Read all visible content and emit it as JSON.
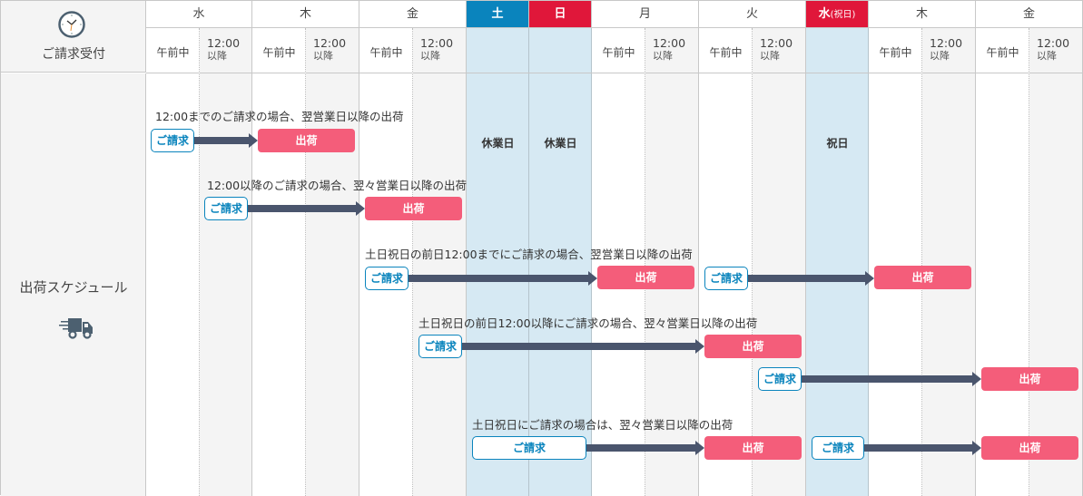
{
  "header": {
    "reception_label": "ご請求受付",
    "clock_icon": "clock-icon",
    "days": [
      {
        "label": "水",
        "type": "weekday"
      },
      {
        "label": "木",
        "type": "weekday"
      },
      {
        "label": "金",
        "type": "weekday"
      },
      {
        "label": "土",
        "type": "saturday"
      },
      {
        "label": "日",
        "type": "sunday"
      },
      {
        "label": "月",
        "type": "weekday"
      },
      {
        "label": "火",
        "type": "weekday"
      },
      {
        "label": "水",
        "sub": "(祝日)",
        "type": "holiday"
      },
      {
        "label": "木",
        "type": "weekday"
      },
      {
        "label": "金",
        "type": "weekday"
      }
    ],
    "slot_am": "午前中",
    "slot_pm_time": "12:00",
    "slot_pm_sub": "以降"
  },
  "schedule": {
    "label": "出荷スケジュール",
    "truck_icon": "delivery-truck-icon",
    "off_labels": {
      "sat": "休業日",
      "sun": "休業日",
      "holiday": "祝日"
    },
    "request_label": "ご請求",
    "ship_label": "出荷",
    "rules": [
      "12:00までのご請求の場合、翌営業日以降の出荷",
      "12:00以降のご請求の場合、翌々営業日以降の出荷",
      "土日祝日の前日12:00までにご請求の場合、翌営業日以降の出荷",
      "土日祝日の前日12:00以降にご請求の場合、翌々営業日以降の出荷",
      "土日祝日にご請求の場合は、翌々営業日以降の出荷"
    ]
  },
  "colors": {
    "saturday": "#0a84bd",
    "sunday_holiday": "#e0173a",
    "offday_bg": "#d6e9f3",
    "ship": "#f45d7a",
    "arrow": "#4a556d"
  }
}
